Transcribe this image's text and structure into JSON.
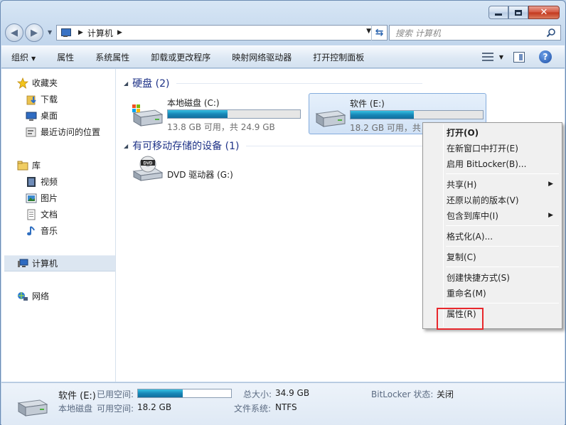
{
  "window": {
    "controls": [
      "minimize",
      "maximize",
      "close"
    ]
  },
  "address": {
    "location": "计算机",
    "search_placeholder": "搜索 计算机"
  },
  "toolbar": {
    "organize": "组织",
    "properties": "属性",
    "system_properties": "系统属性",
    "uninstall": "卸载或更改程序",
    "map_drive": "映射网络驱动器",
    "control_panel": "打开控制面板"
  },
  "sidebar": {
    "favorites": {
      "label": "收藏夹",
      "items": [
        "下载",
        "桌面",
        "最近访问的位置"
      ]
    },
    "libraries": {
      "label": "库",
      "items": [
        "视频",
        "图片",
        "文档",
        "音乐"
      ]
    },
    "computer": "计算机",
    "network": "网络"
  },
  "groups": {
    "hard_disks": "硬盘 (2)",
    "removable": "有可移动存储的设备 (1)"
  },
  "drives": [
    {
      "name": "本地磁盘 (C:)",
      "info": "13.8 GB 可用，共 24.9 GB",
      "used_fraction": 0.45
    },
    {
      "name": "软件 (E:)",
      "info": "18.2 GB 可用，共 34.9 GB",
      "used_fraction": 0.48
    },
    {
      "name": "DVD 驱动器 (G:)"
    }
  ],
  "context_menu": {
    "open": "打开(O)",
    "open_new_window": "在新窗口中打开(E)",
    "bitlocker": "启用 BitLocker(B)...",
    "share": "共享(H)",
    "restore": "还原以前的版本(V)",
    "include_library": "包含到库中(I)",
    "format": "格式化(A)...",
    "copy": "复制(C)",
    "create_shortcut": "创建快捷方式(S)",
    "rename": "重命名(M)",
    "properties": "属性(R)"
  },
  "details": {
    "name": "软件 (E:)",
    "type": "本地磁盘",
    "used_label": "已用空间:",
    "free_label": "可用空间:",
    "free_value": "18.2 GB",
    "total_label": "总大小:",
    "total_value": "34.9 GB",
    "fs_label": "文件系统:",
    "fs_value": "NTFS",
    "bitlocker_label": "BitLocker 状态:",
    "bitlocker_value": "关闭",
    "used_fraction": 0.48
  },
  "colors": {
    "accent": "#1e3287",
    "highlight": "#e8272c",
    "bar": "#1787b7"
  }
}
